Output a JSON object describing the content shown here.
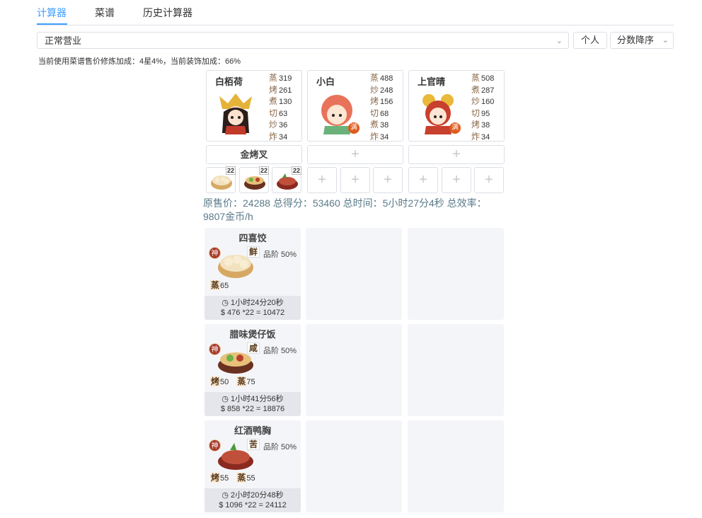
{
  "tabs": [
    {
      "label": "计算器",
      "active": true
    },
    {
      "label": "菜谱",
      "active": false
    },
    {
      "label": "历史计算器",
      "active": false
    }
  ],
  "mode_select": {
    "value": "正常营业"
  },
  "personal_button": "个人",
  "sort_select": {
    "value": "分数降序"
  },
  "bonus_text": "当前使用菜谱售价修炼加成：4星4%，当前装饰加成：66%",
  "chefs": [
    {
      "name": "白栢荷",
      "full_badge": "",
      "skills": [
        {
          "k": "蒸",
          "v": "319"
        },
        {
          "k": "烤",
          "v": "261"
        },
        {
          "k": "煮",
          "v": "130"
        },
        {
          "k": "切",
          "v": "63"
        },
        {
          "k": "炒",
          "v": "36"
        },
        {
          "k": "炸",
          "v": "34"
        }
      ]
    },
    {
      "name": "小白",
      "full_badge": "满",
      "skills": [
        {
          "k": "蒸",
          "v": "488"
        },
        {
          "k": "炒",
          "v": "248"
        },
        {
          "k": "烤",
          "v": "156"
        },
        {
          "k": "切",
          "v": "68"
        },
        {
          "k": "煮",
          "v": "38"
        },
        {
          "k": "炸",
          "v": "34"
        }
      ]
    },
    {
      "name": "上官晴",
      "full_badge": "满",
      "skills": [
        {
          "k": "蒸",
          "v": "508"
        },
        {
          "k": "煮",
          "v": "287"
        },
        {
          "k": "炒",
          "v": "160"
        },
        {
          "k": "切",
          "v": "95"
        },
        {
          "k": "烤",
          "v": "38"
        },
        {
          "k": "炸",
          "v": "34"
        }
      ]
    }
  ],
  "equipment": [
    "金烤叉"
  ],
  "plus_glyph": "+",
  "dish_slots": [
    {
      "qty": "22",
      "icon": "dumpling-basket-icon"
    },
    {
      "qty": "22",
      "icon": "claypot-rice-icon"
    },
    {
      "qty": "22",
      "icon": "duck-breast-icon"
    }
  ],
  "summary": "原售价：24288 总得分：53460 总时间：5小时27分4秒 总效率：9807金币/h",
  "recipes": [
    {
      "name": "四喜饺",
      "god": "神",
      "flavor": "鲜",
      "quality": "品阶 50%",
      "skills": [
        {
          "k": "蒸",
          "v": "65"
        }
      ],
      "time": "1小时24分20秒",
      "price": "$ 476 *22 = 10472",
      "icon": "dumpling-basket-icon"
    },
    {
      "name": "腊味煲仔饭",
      "god": "神",
      "flavor": "咸",
      "quality": "品阶 50%",
      "skills": [
        {
          "k": "烤",
          "v": "50"
        },
        {
          "k": "蒸",
          "v": "75"
        }
      ],
      "time": "1小时41分56秒",
      "price": "$ 858 *22 = 18876",
      "icon": "claypot-rice-icon"
    },
    {
      "name": "红酒鸭胸",
      "god": "神",
      "flavor": "苦",
      "quality": "品阶 50%",
      "skills": [
        {
          "k": "烤",
          "v": "55"
        },
        {
          "k": "蒸",
          "v": "55"
        }
      ],
      "time": "2小时20分48秒",
      "price": "$ 1096 *22 = 24112",
      "icon": "duck-breast-icon"
    }
  ],
  "colors": {
    "accent": "#409eff",
    "border": "#dcdfe6",
    "card_bg": "#f4f5f8",
    "summary_text": "#5a7a8a"
  }
}
